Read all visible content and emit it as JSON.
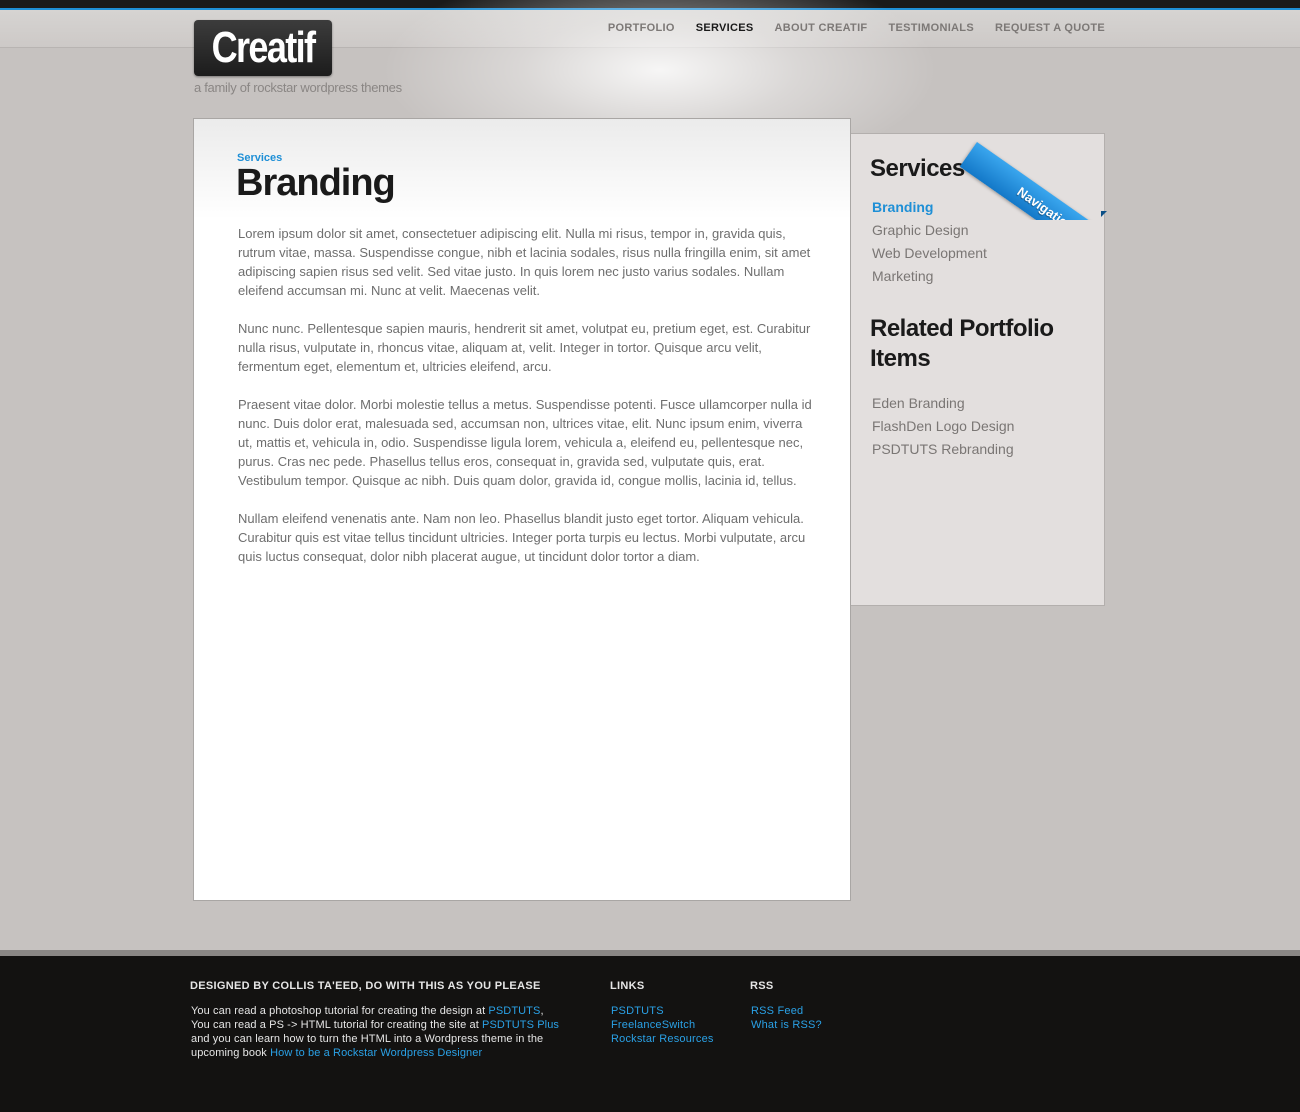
{
  "header": {
    "logo_text": "Creatif",
    "tagline": "a family of rockstar wordpress themes",
    "nav": [
      {
        "label": "PORTFOLIO",
        "active": false
      },
      {
        "label": "SERVICES",
        "active": true
      },
      {
        "label": "ABOUT CREATIF",
        "active": false
      },
      {
        "label": "TESTIMONIALS",
        "active": false
      },
      {
        "label": "REQUEST A QUOTE",
        "active": false
      }
    ]
  },
  "main": {
    "breadcrumb": "Services",
    "title": "Branding",
    "paragraphs": [
      "Lorem ipsum dolor sit amet, consectetuer adipiscing elit. Nulla mi risus, tempor in, gravida quis, rutrum vitae, massa. Suspendisse congue, nibh et lacinia sodales, risus nulla fringilla enim, sit amet adipiscing sapien risus sed velit. Sed vitae justo. In quis lorem nec justo varius sodales. Nullam eleifend accumsan mi. Nunc at velit. Maecenas velit.",
      "Nunc nunc. Pellentesque sapien mauris, hendrerit sit amet, volutpat eu, pretium eget, est. Curabitur nulla risus, vulputate in, rhoncus vitae, aliquam at, velit. Integer in tortor. Quisque arcu velit, fermentum eget, elementum et, ultricies eleifend, arcu.",
      "Praesent vitae dolor. Morbi molestie tellus a metus. Suspendisse potenti. Fusce ullamcorper nulla id nunc. Duis dolor erat, malesuada sed, accumsan non, ultrices vitae, elit. Nunc ipsum enim, viverra ut, mattis et, vehicula in, odio. Suspendisse ligula lorem, vehicula a, eleifend eu, pellentesque nec, purus. Cras nec pede. Phasellus tellus eros, consequat in, gravida sed, vulputate quis, erat. Vestibulum tempor. Quisque ac nibh. Duis quam dolor, gravida id, congue mollis, lacinia id, tellus.",
      "Nullam eleifend venenatis ante. Nam non leo. Phasellus blandit justo eget tortor. Aliquam vehicula. Curabitur quis est vitae tellus tincidunt ultricies. Integer porta turpis eu lectus. Morbi vulputate, arcu quis luctus consequat, dolor nibh placerat augue, ut tincidunt dolor tortor a diam."
    ]
  },
  "sidebar": {
    "ribbon_label": "Navigation",
    "services_heading": "Services",
    "services": [
      {
        "label": "Branding",
        "active": true
      },
      {
        "label": "Graphic Design",
        "active": false
      },
      {
        "label": "Web Development",
        "active": false
      },
      {
        "label": "Marketing",
        "active": false
      }
    ],
    "related_heading_line1": "Related Portfolio",
    "related_heading_line2": "Items",
    "related": [
      "Eden Branding",
      "FlashDen Logo Design",
      "PSDTUTS Rebranding"
    ]
  },
  "footer": {
    "credit_heading": "DESIGNED BY COLLIS TA'EED, DO WITH THIS AS YOU PLEASE",
    "text_1": "You can read a photoshop tutorial for creating the design at ",
    "link_1": "PSDTUTS",
    "text_1b": ",",
    "text_2": "You can read a PS -> HTML tutorial for creating the site at ",
    "link_2": "PSDTUTS Plus",
    "text_3": "and you can learn how to turn the HTML into a Wordpress theme in the upcoming book ",
    "link_3": "How to be a Rockstar Wordpress Designer",
    "links_heading": "LINKS",
    "links": [
      "PSDTUTS",
      "FreelanceSwitch",
      "Rockstar Resources"
    ],
    "rss_heading": "RSS",
    "rss_links": [
      "RSS Feed",
      "What is RSS?"
    ]
  },
  "colors": {
    "accent": "#1e8fd6",
    "page_bg": "#c6c2c0",
    "footer_bg": "#131211",
    "sidebar_bg": "#e3dfde"
  }
}
